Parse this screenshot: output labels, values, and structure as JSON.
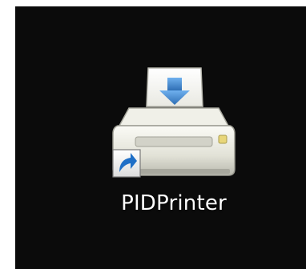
{
  "desktop": {
    "shortcut": {
      "label": "PIDPrinter",
      "icon": "printer-icon",
      "overlay_icon": "shortcut-arrow-icon"
    }
  },
  "colors": {
    "background": "#0b0b0b",
    "label": "#ffffff",
    "arrow_blue": "#3a7fc8",
    "shortcut_badge_blue": "#1f6fc7"
  }
}
